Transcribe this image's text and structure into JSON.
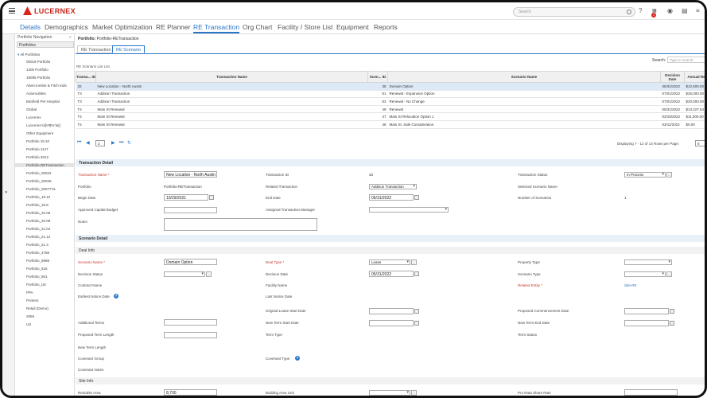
{
  "app": {
    "brand": "LUCERNEX",
    "search_placeholder": "Search",
    "notification_count": "1"
  },
  "nav": {
    "items": [
      "Details",
      "Demographics",
      "Market Optimization",
      "RE Planner",
      "RE Transaction",
      "Org Chart",
      "Facility / Store List",
      "Equipment",
      "Reports"
    ],
    "active": "RE Transaction"
  },
  "sidebar": {
    "title": "Portfolio Navigation",
    "selector": "Portfolios",
    "root": "All Portfolios",
    "items": [
      "00018 Portfolio",
      "1305 Portfolio",
      "18085 Portfolio",
      "Abercrombie & Fitch Kids",
      "Automobiles",
      "Banfield Pet Hospital",
      "Global",
      "Lucernex",
      "Lucernex's@#$%^&()",
      "Other Equipment",
      "Portfolio 18.10",
      "Portfolio-1147",
      "Portfolio-2012",
      "Portfolio-RETransaction",
      "Portfolio_00022",
      "Portfolio_00029",
      "Portfolio_000777a",
      "Portfolio_19.10",
      "Portfolio_19.8",
      "Portfolio_20.06",
      "Portfolio_20.08",
      "Portfolio_21.04",
      "Portfolio_21.12",
      "Portfolio_21.3",
      "Portfolio_4788",
      "Portfolio_8998",
      "Portfolio_815",
      "Portfolio_801",
      "Portfolio_UK",
      "PPA",
      "Printers",
      "Retail (Demo)",
      "SRM",
      "US"
    ],
    "selected": "Portfolio-RETransaction"
  },
  "breadcrumb": {
    "label": "Portfolio:",
    "value": "Portfolio-RETransaction"
  },
  "subtabs": [
    "RE Transaction",
    "RE Scenario"
  ],
  "grid": {
    "caption": "RE Scenario List List",
    "search_label": "Search:",
    "search_placeholder": "Type to search",
    "columns": [
      "Transa... ID",
      "Transaction Name",
      "Scen... ID",
      "Scenario Name",
      "Decision Date",
      "Annual Re"
    ],
    "rows": [
      [
        "33",
        "New Location - North Austin",
        "38",
        "Domain Option",
        "05/31/2022",
        "$12,500.00"
      ],
      [
        "T3",
        "Addison Transaction",
        "51",
        "Renewal - Expansion Option",
        "07/01/2022",
        "$25,000.00"
      ],
      [
        "T3",
        "Addison Transaction",
        "53",
        "Renewal - No Change",
        "07/01/2022",
        "$20,000.00"
      ],
      [
        "T4",
        "Main St Renewal",
        "49",
        "Renewal",
        "05/31/2022",
        "$13,227.64"
      ],
      [
        "T4",
        "Main St Renewal",
        "47",
        "Main St Relocation Option 1",
        "03/18/2022",
        "$11,000.00"
      ],
      [
        "T4",
        "Main St Renewal",
        "48",
        "Main St. Sale Consideration",
        "03/11/2022",
        "$0.00"
      ]
    ],
    "page": "2",
    "paging_info": "Displaying 7 - 12 of 14",
    "rows_per_page_label": "Rows per Page:",
    "rows_per_page": "6"
  },
  "transaction_detail": {
    "header": "Transaction Detail",
    "transaction_name_label": "Transaction Name *",
    "transaction_name": "New Location - North Austin",
    "transaction_id_label": "Transaction ID",
    "transaction_id": "33",
    "transaction_status_label": "Transaction Status",
    "transaction_status": "In Process",
    "portfolio_label": "Portfolio",
    "portfolio": "Portfolio-RETransaction",
    "related_transaction_label": "Related Transaction",
    "related_transaction": "Addison Transaction",
    "selected_scenario_label": "Selected Scenario Name",
    "begin_date_label": "Begin Date",
    "begin_date": "10/29/2021",
    "end_date_label": "End Date",
    "end_date": "05/31/2022",
    "num_scenarios_label": "Number of Scenarios",
    "num_scenarios": "1",
    "approved_budget_label": "Approved Capital Budget",
    "assigned_manager_label": "Assigned Transaction Manager",
    "notes_label": "Notes"
  },
  "scenario_detail": {
    "header": "Scenario Detail",
    "deal_info_header": "Deal Info",
    "scenario_name_label": "Scenario Name *",
    "scenario_name": "Domain Option",
    "deal_type_label": "Deal Type *",
    "deal_type": "Lease",
    "property_type_label": "Property Type",
    "decision_status_label": "Decision Status",
    "decision_date_label": "Decision Date",
    "decision_date": "05/31/2022",
    "scenario_type_label": "Scenario Type",
    "contract_name_label": "Contract Name",
    "facility_name_label": "Facility Name",
    "related_entity_label": "Related Entity *",
    "related_entity": "Site-RE",
    "earliest_notice_label": "Earliest Notice Date",
    "last_notice_label": "Last Notice Date",
    "orig_lease_start_label": "Original Lease Start Date",
    "proposed_commencement_label": "Proposed Commencement Date",
    "additional_terms_label": "Additional Terms",
    "new_term_start_label": "New Term Start Date",
    "new_term_end_label": "New Term End Date",
    "proposed_term_length_label": "Proposed Term Length",
    "term_type_label": "Term Type",
    "term_status_label": "Term Status",
    "new_term_length_label": "New Term Length",
    "covenant_group_label": "Covenant Group",
    "covenant_type_label": "Covenant Type",
    "covenant_notes_label": "Covenant Notes",
    "site_info_header": "Site Info",
    "rentable_area_label": "Rentable Area",
    "rentable_area": "8,700",
    "building_area_unit_label": "Building Area Unit",
    "pro_rata_label": "Pro Rata Share Rate"
  },
  "colors": {
    "accent": "#2a76c6",
    "brand": "#d9261c",
    "required": "#c0392b"
  }
}
